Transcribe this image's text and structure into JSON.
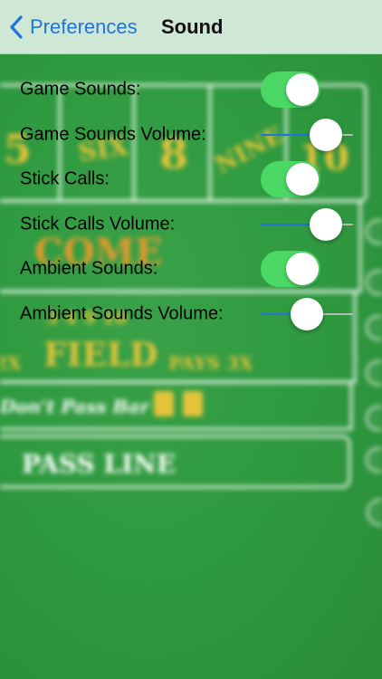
{
  "nav": {
    "back_label": "Preferences",
    "title": "Sound"
  },
  "settings": [
    {
      "label": "Game Sounds:",
      "control": "toggle",
      "on": true
    },
    {
      "label": "Game Sounds Volume:",
      "control": "slider",
      "value": 0.82
    },
    {
      "label": "Stick Calls:",
      "control": "toggle",
      "on": true
    },
    {
      "label": "Stick Calls Volume:",
      "control": "slider",
      "value": 0.82
    },
    {
      "label": "Ambient Sounds:",
      "control": "toggle",
      "on": true
    },
    {
      "label": "Ambient Sounds Volume:",
      "control": "slider",
      "value": 0.5
    }
  ],
  "table_background": {
    "numbers": [
      "5",
      "SIX",
      "8",
      "NINE",
      "10"
    ],
    "come_label": "COME",
    "field_label": "FIELD",
    "field_left": "2X",
    "field_pays": "PAYS 3X",
    "field_numbers": "3 4 9 10",
    "dont_pass_label": "Don't Pass Bar",
    "pass_line_label": "PASS LINE"
  },
  "colors": {
    "accent": "#1f74d8",
    "toggle_on": "#4bd864",
    "navbar_bg": "#cfe8d6",
    "felt": "#2f8f3e",
    "table_text": "#e6c43a"
  }
}
